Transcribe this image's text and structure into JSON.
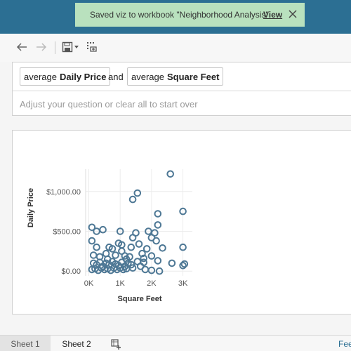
{
  "toast": {
    "message": "Saved viz to workbook \"Neighborhood Analysis\"",
    "link_label": "View",
    "close_icon": "close-icon"
  },
  "toolbar": {
    "icons": [
      "back-arrow-icon",
      "forward-arrow-icon",
      "save-icon",
      "dropdown-caret-icon",
      "duplicate-viz-icon"
    ]
  },
  "query": {
    "pills": [
      {
        "prefix": "average",
        "field": "Daily Price"
      },
      {
        "prefix": "average",
        "field": "Square Feet"
      }
    ],
    "conjunction": "and",
    "placeholder": "Adjust your question or clear all to start over"
  },
  "chart_data": {
    "type": "scatter",
    "xlabel": "Square Feet",
    "ylabel": "Daily Price",
    "x_ticks": [
      "0K",
      "1K",
      "2K",
      "3K"
    ],
    "y_ticks": [
      "$0.00",
      "$500.00",
      "$1,000.00"
    ],
    "xlim": [
      -100,
      3300
    ],
    "ylim": [
      -60,
      1280
    ],
    "marker": "hollow-circle",
    "color": "#4e7895",
    "points": [
      [
        2600,
        1220
      ],
      [
        1550,
        980
      ],
      [
        1400,
        900
      ],
      [
        2200,
        720
      ],
      [
        3000,
        750
      ],
      [
        100,
        550
      ],
      [
        250,
        500
      ],
      [
        450,
        520
      ],
      [
        1000,
        500
      ],
      [
        1500,
        480
      ],
      [
        1900,
        500
      ],
      [
        2100,
        480
      ],
      [
        2200,
        580
      ],
      [
        1400,
        420
      ],
      [
        2000,
        420
      ],
      [
        2150,
        380
      ],
      [
        3000,
        300
      ],
      [
        100,
        380
      ],
      [
        250,
        300
      ],
      [
        650,
        300
      ],
      [
        750,
        280
      ],
      [
        1050,
        330
      ],
      [
        1350,
        300
      ],
      [
        1850,
        280
      ],
      [
        2350,
        290
      ],
      [
        150,
        200
      ],
      [
        350,
        180
      ],
      [
        600,
        150
      ],
      [
        850,
        200
      ],
      [
        1150,
        190
      ],
      [
        1300,
        180
      ],
      [
        1700,
        220
      ],
      [
        2000,
        190
      ],
      [
        150,
        100
      ],
      [
        250,
        80
      ],
      [
        350,
        110
      ],
      [
        450,
        60
      ],
      [
        550,
        100
      ],
      [
        650,
        80
      ],
      [
        750,
        120
      ],
      [
        850,
        90
      ],
      [
        950,
        70
      ],
      [
        1050,
        110
      ],
      [
        1150,
        60
      ],
      [
        1250,
        100
      ],
      [
        1350,
        80
      ],
      [
        1550,
        120
      ],
      [
        1650,
        60
      ],
      [
        1750,
        110
      ],
      [
        2200,
        130
      ],
      [
        2650,
        100
      ],
      [
        3000,
        70
      ],
      [
        3050,
        90
      ],
      [
        100,
        20
      ],
      [
        200,
        30
      ],
      [
        300,
        10
      ],
      [
        400,
        40
      ],
      [
        500,
        20
      ],
      [
        600,
        30
      ],
      [
        700,
        10
      ],
      [
        800,
        40
      ],
      [
        900,
        20
      ],
      [
        1000,
        40
      ],
      [
        1100,
        20
      ],
      [
        1200,
        30
      ],
      [
        1400,
        40
      ],
      [
        1800,
        20
      ],
      [
        2000,
        10
      ],
      [
        2250,
        0
      ],
      [
        1050,
        250
      ],
      [
        950,
        350
      ],
      [
        1200,
        150
      ],
      [
        550,
        220
      ],
      [
        1600,
        340
      ],
      [
        1750,
        160
      ]
    ]
  },
  "tabs": [
    {
      "label": "Sheet 1",
      "active": true
    },
    {
      "label": "Sheet 2",
      "active": false
    }
  ],
  "new_sheet_icon": "new-sheet-icon",
  "feedback_label": "Fee"
}
